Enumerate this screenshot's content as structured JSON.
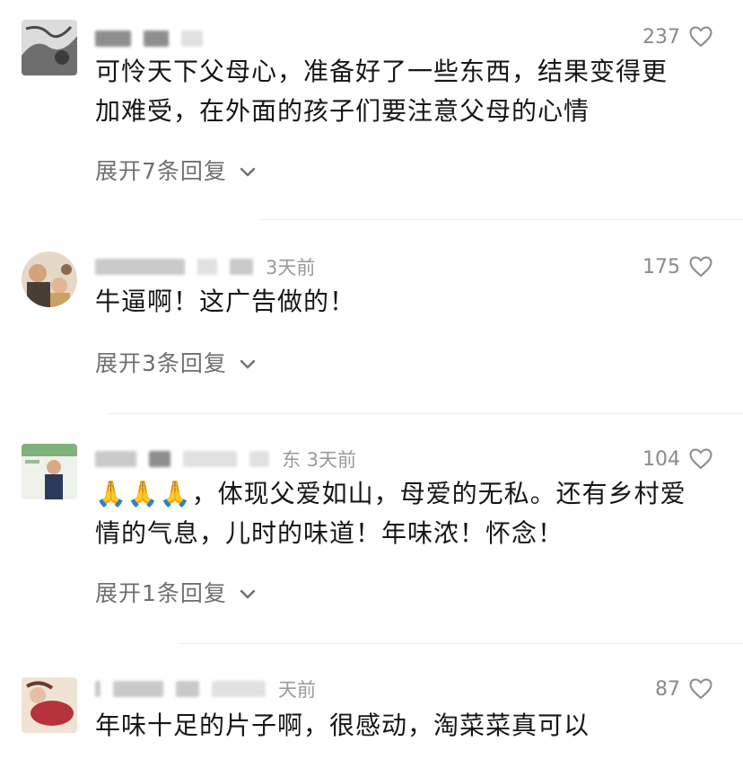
{
  "comments": [
    {
      "time": "",
      "likes": "237",
      "text_lines": [
        "可怜天下父母心，准备好了一些东西，结果变得更",
        "加难受，在外面的孩子们要注意父母的心情"
      ],
      "replies_label": "展开7条回复"
    },
    {
      "time": "3天前",
      "likes": "175",
      "text_lines": [
        "牛逼啊！这广告做的！"
      ],
      "replies_label": "展开3条回复"
    },
    {
      "time": "东 3天前",
      "likes": "104",
      "text_lines": [
        "🙏🙏🙏，体现父爱如山，母爱的无私。还有乡村爱",
        "情的气息，儿时的味道！年味浓！怀念！"
      ],
      "replies_label": "展开1条回复"
    },
    {
      "time": "天前",
      "likes": "87",
      "text_lines": [
        "年味十足的片子啊，很感动，淘菜菜真可以"
      ]
    }
  ],
  "icons": {
    "like": "heart-outline-icon",
    "expand": "chevron-down-icon"
  },
  "colors": {
    "text": "#161616",
    "meta": "#9a9a9a",
    "divider": "#ececec"
  }
}
